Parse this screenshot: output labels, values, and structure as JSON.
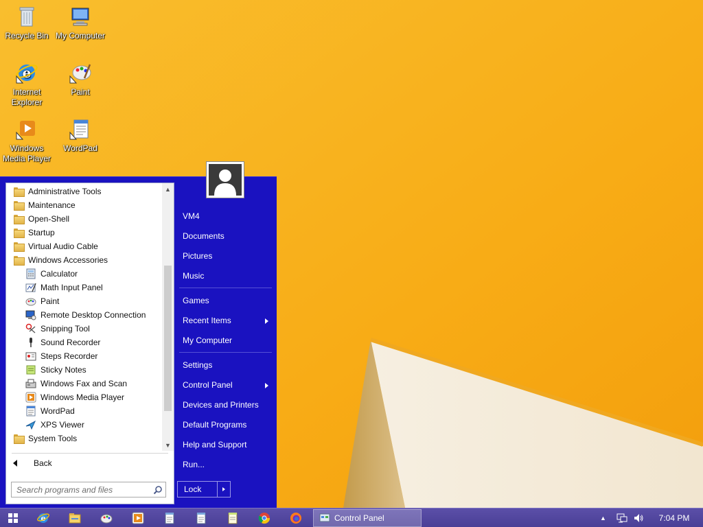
{
  "desktop": {
    "icons": [
      {
        "label": "Recycle Bin"
      },
      {
        "label": "My Computer"
      },
      {
        "label": "Internet Explorer"
      },
      {
        "label": "Paint"
      },
      {
        "label": "Windows Media Player"
      },
      {
        "label": "WordPad"
      }
    ]
  },
  "start_menu": {
    "programs": [
      {
        "label": "Administrative Tools",
        "icon": "folder-icon"
      },
      {
        "label": "Maintenance",
        "icon": "folder-icon"
      },
      {
        "label": "Open-Shell",
        "icon": "folder-icon"
      },
      {
        "label": "Startup",
        "icon": "folder-icon"
      },
      {
        "label": "Virtual Audio Cable",
        "icon": "folder-icon"
      },
      {
        "label": "Windows Accessories",
        "icon": "folder-icon"
      },
      {
        "label": "Calculator",
        "icon": "calculator-icon"
      },
      {
        "label": "Math Input Panel",
        "icon": "math-input-icon"
      },
      {
        "label": "Paint",
        "icon": "paint-icon"
      },
      {
        "label": "Remote Desktop Connection",
        "icon": "remote-desktop-icon"
      },
      {
        "label": "Snipping Tool",
        "icon": "scissors-icon"
      },
      {
        "label": "Sound Recorder",
        "icon": "microphone-icon"
      },
      {
        "label": "Steps Recorder",
        "icon": "steps-recorder-icon"
      },
      {
        "label": "Sticky Notes",
        "icon": "sticky-notes-icon"
      },
      {
        "label": "Windows Fax and Scan",
        "icon": "fax-icon"
      },
      {
        "label": "Windows Media Player",
        "icon": "media-player-icon"
      },
      {
        "label": "WordPad",
        "icon": "wordpad-icon"
      },
      {
        "label": "XPS Viewer",
        "icon": "xps-viewer-icon"
      },
      {
        "label": "System Tools",
        "icon": "folder-icon"
      }
    ],
    "back_label": "Back",
    "search_placeholder": "Search programs and files",
    "right_items": [
      {
        "label": "VM4"
      },
      {
        "label": "Documents"
      },
      {
        "label": "Pictures"
      },
      {
        "label": "Music"
      },
      {
        "label": "Games"
      },
      {
        "label": "Recent Items",
        "submenu": true
      },
      {
        "label": "My Computer"
      },
      {
        "label": "Settings"
      },
      {
        "label": "Control Panel",
        "submenu": true
      },
      {
        "label": "Devices and Printers"
      },
      {
        "label": "Default Programs"
      },
      {
        "label": "Help and Support"
      },
      {
        "label": "Run..."
      }
    ],
    "lock_label": "Lock"
  },
  "taskbar": {
    "pinned": [
      "internet-explorer-icon",
      "file-explorer-icon",
      "paint-icon",
      "media-player-icon",
      "notepad-icon",
      "notepad-icon",
      "chrome-icon",
      "firefox-icon"
    ],
    "active_task": "Control Panel",
    "clock": "7:04 PM"
  },
  "colors": {
    "start_menu_bg": "#1a12c0",
    "taskbar_bg": "#4a3f96",
    "wallpaper": "#f8ab14"
  }
}
